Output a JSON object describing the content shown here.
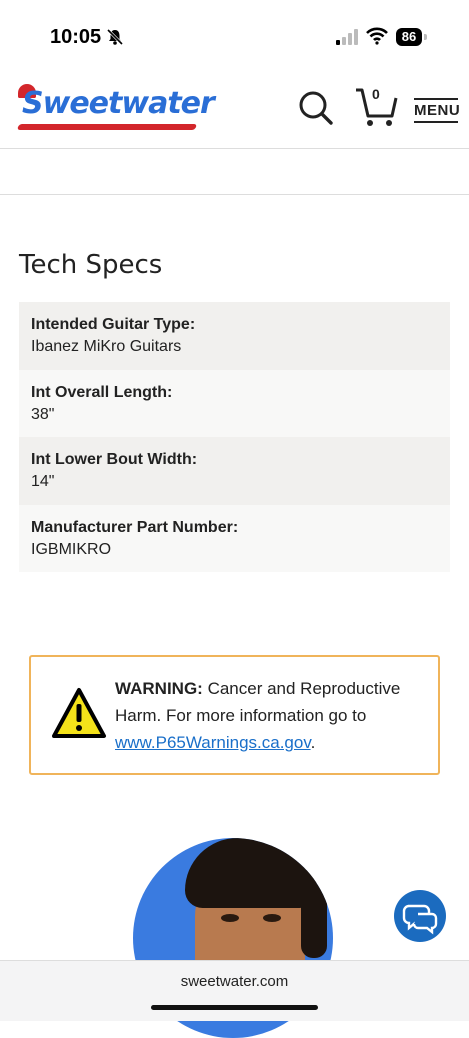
{
  "status_bar": {
    "time": "10:05",
    "battery": "86"
  },
  "header": {
    "logo_text": "Sweetwater",
    "cart_count": "0",
    "menu_label": "MENU"
  },
  "tech_specs": {
    "title": "Tech Specs",
    "rows": [
      {
        "label": "Intended Guitar Type:",
        "value": "Ibanez MiKro Guitars"
      },
      {
        "label": "Int Overall Length:",
        "value": "38\""
      },
      {
        "label": "Int Lower Bout Width:",
        "value": "14\""
      },
      {
        "label": "Manufacturer Part Number:",
        "value": "IGBMIKRO"
      }
    ]
  },
  "warning": {
    "heading": "WARNING:",
    "text": "Cancer and Reproductive Harm. For more information go to",
    "link": "www.P65Warnings.ca.gov",
    "trailing": "."
  },
  "browser": {
    "url": "sweetwater.com"
  },
  "colors": {
    "brand_blue": "#2a6ed6",
    "brand_red": "#d3262b",
    "warning_border": "#f0b45a",
    "chat_blue": "#1b6bbf",
    "link": "#1a6fc9"
  },
  "icons": [
    "bell-slash-icon",
    "signal-icon",
    "wifi-icon",
    "battery-icon",
    "search-icon",
    "cart-icon",
    "warning-triangle-icon",
    "chat-icon"
  ]
}
